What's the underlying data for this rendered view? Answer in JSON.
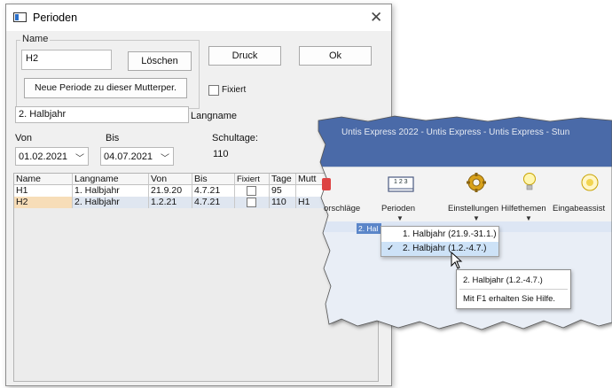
{
  "dialog": {
    "title": "Perioden",
    "name_group_label": "Name",
    "name_value": "H2",
    "delete_button": "Löschen",
    "print_button": "Druck",
    "ok_button": "Ok",
    "new_period_button": "Neue Periode zu dieser Mutterper.",
    "frozen_label": "Fixiert",
    "long_name_value": "2. Halbjahr",
    "long_name_label": "Langname",
    "from_label": "Von",
    "to_label": "Bis",
    "school_days_label": "Schultage:",
    "from_value": "01.02.2021",
    "to_value": "04.07.2021",
    "school_days_value": "110"
  },
  "grid": {
    "headers": [
      "Name",
      "Langname",
      "Von",
      "Bis",
      "Fixiert",
      "Tage",
      "Mutt"
    ],
    "rows": [
      {
        "name": "H1",
        "longname": "1. Halbjahr",
        "from": "21.9.20",
        "to": "4.7.21",
        "frozen": false,
        "days": "95",
        "mother": ""
      },
      {
        "name": "H2",
        "longname": "2. Halbjahr",
        "from": "1.2.21",
        "to": "4.7.21",
        "frozen": false,
        "days": "110",
        "mother": "H1"
      }
    ]
  },
  "untis": {
    "title": "Untis Express 2022 - Untis Express  -  Untis Express  -  Stun",
    "ribbon": {
      "left_partial": "orschläge",
      "perioden": "Perioden",
      "perioden_icon_text": "1 2 3",
      "einstellungen": "Einstellungen",
      "hilfethemen": "Hilfethemen",
      "eingabe": "Eingabeassist"
    },
    "period_chip": "2. Hal",
    "menu": [
      {
        "label": "1. Halbjahr (21.9.-31.1.)",
        "checked": false
      },
      {
        "label": "2. Halbjahr (1.2.-4.7.)",
        "checked": true,
        "check": "✓"
      }
    ],
    "tooltip": {
      "title": "2. Halbjahr (1.2.-4.7.)",
      "help": "Mit F1 erhalten Sie Hilfe."
    },
    "colors": {
      "titlebar": "#4a6aa8",
      "ribbon": "#f3f3f3",
      "ribbon_sub": "#dde6f4",
      "highlight": "#cde2f7"
    }
  }
}
